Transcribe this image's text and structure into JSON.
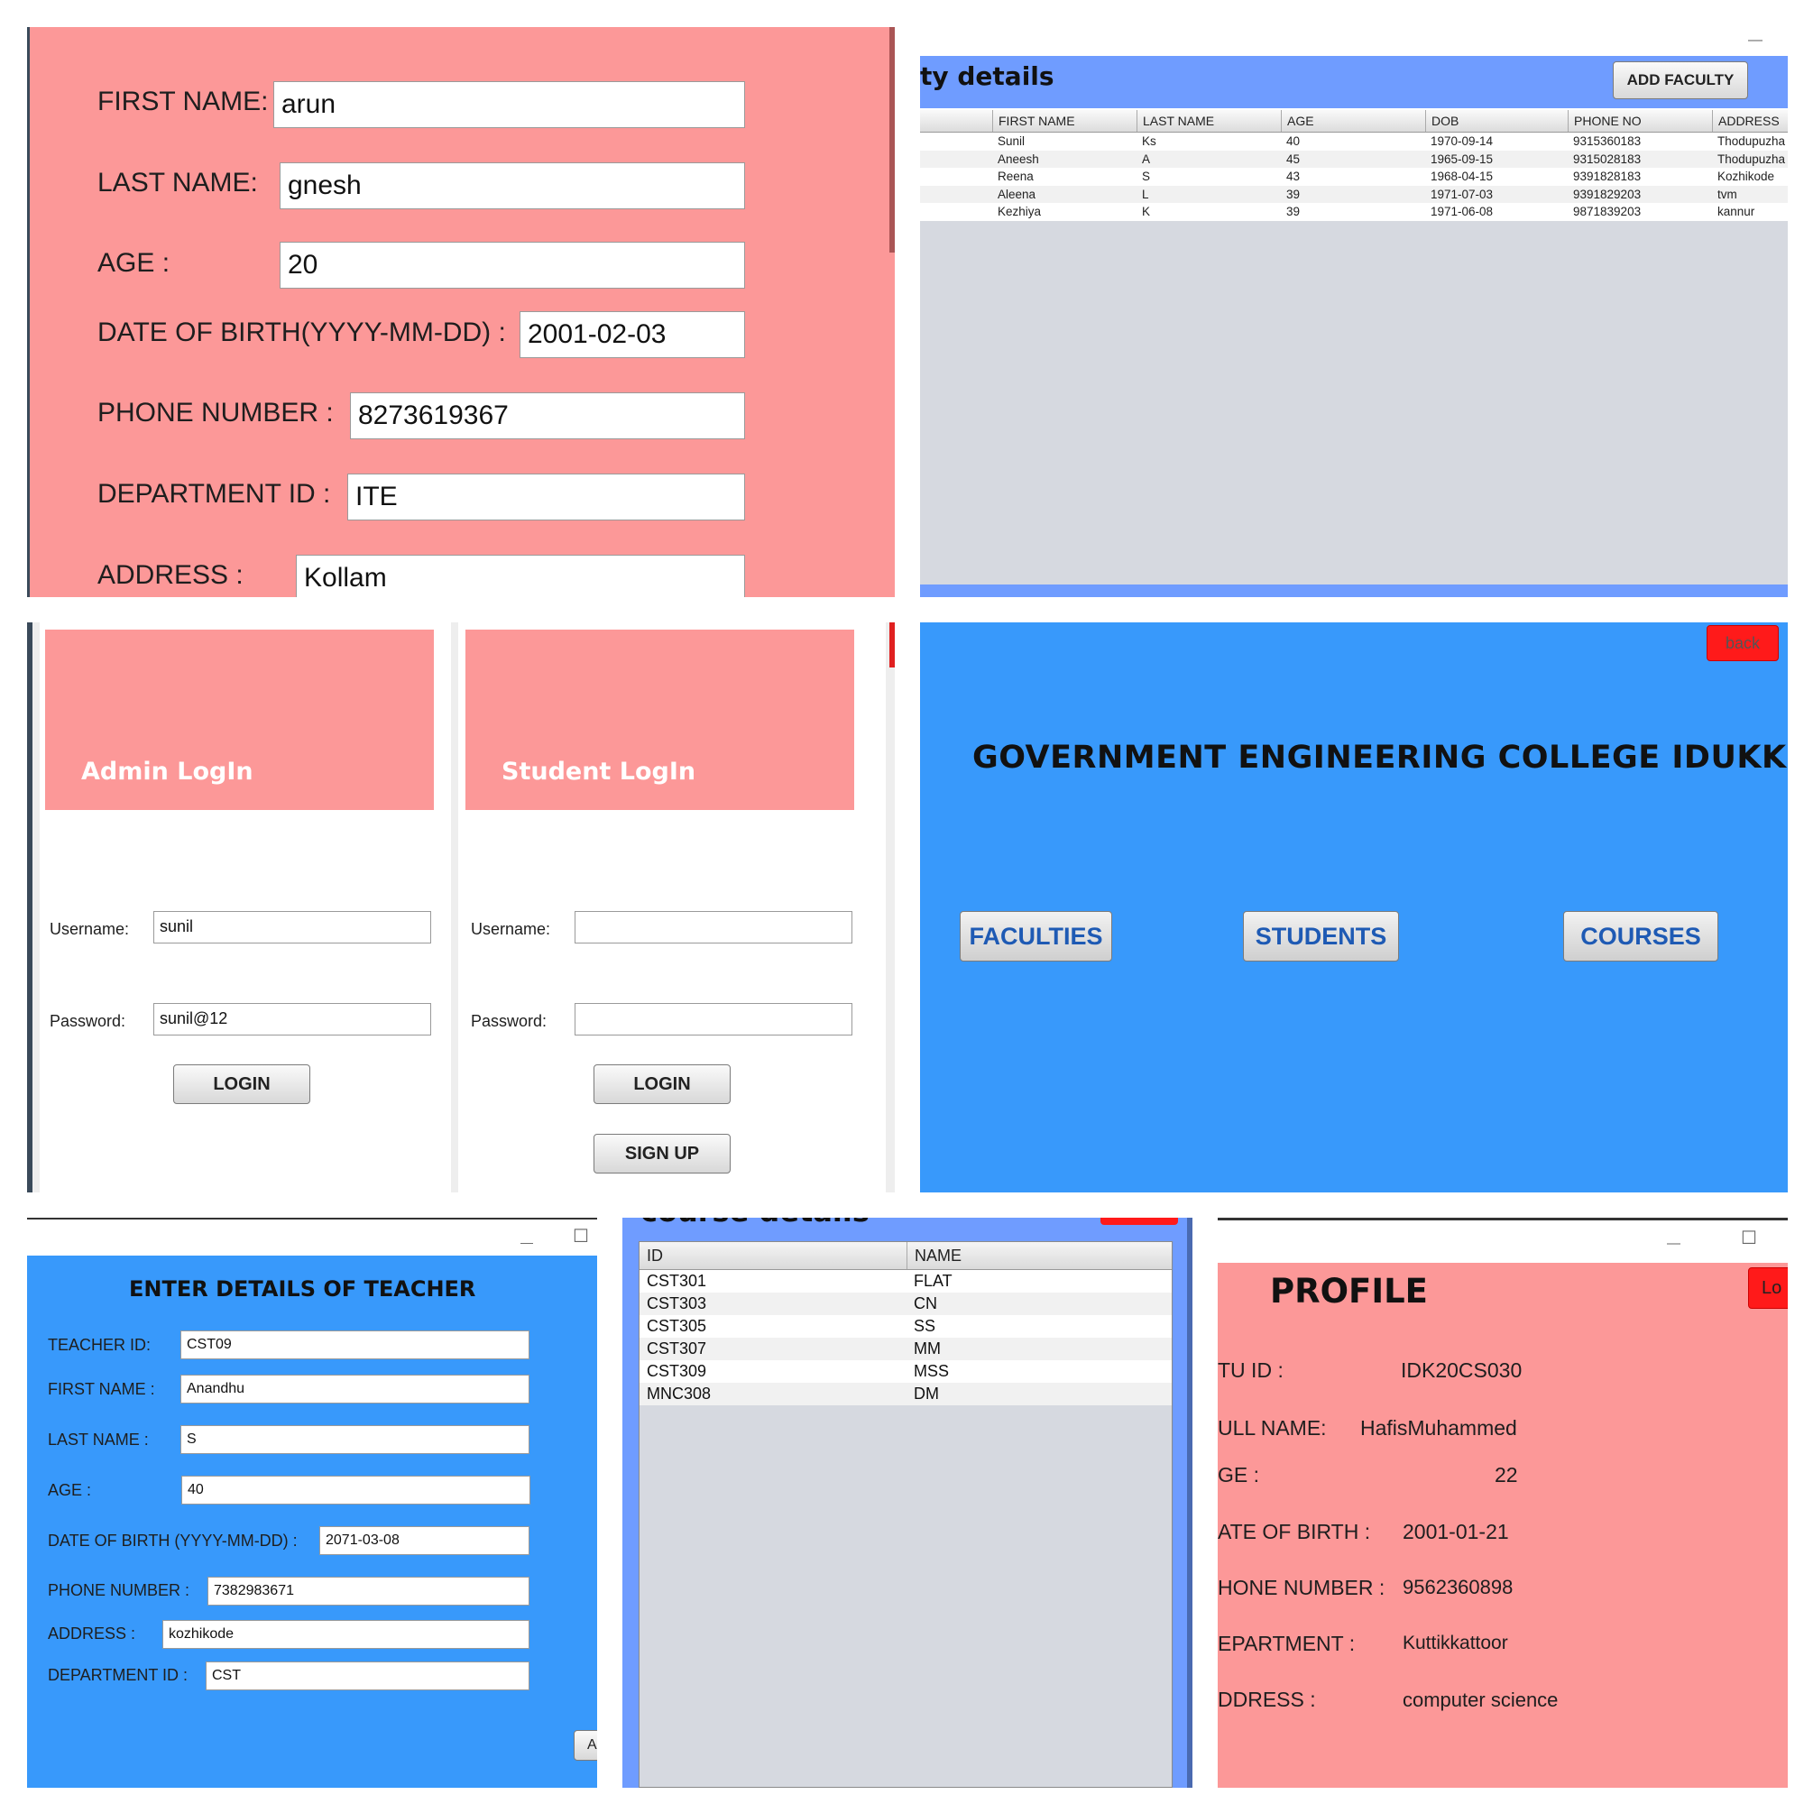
{
  "panel_teacher_form": {
    "first_name_label": "FIRST NAME:",
    "first_name_value": "arun",
    "last_name_label": "LAST NAME:",
    "last_name_value": "gnesh",
    "age_label": "AGE :",
    "age_value": "20",
    "dob_label": "DATE OF BIRTH(YYYY-MM-DD) :",
    "dob_value": "2001-02-03",
    "phone_label": "PHONE NUMBER :",
    "phone_value": "8273619367",
    "dept_label": "DEPARTMENT ID :",
    "dept_value": "ITE",
    "address_label": "ADDRESS :",
    "address_value": "Kollam"
  },
  "panel_faculty_details": {
    "title": "ty details",
    "add_button": "ADD FACULTY",
    "columns": [
      "FIRST NAME",
      "LAST NAME",
      "AGE",
      "DOB",
      "PHONE NO",
      "ADDRESS"
    ],
    "rows": [
      [
        "Sunil",
        "Ks",
        "40",
        "1970-09-14",
        "9315360183",
        "Thodupuzha"
      ],
      [
        "Aneesh",
        "A",
        "45",
        "1965-09-15",
        "9315028183",
        "Thodupuzha"
      ],
      [
        "Reena",
        "S",
        "43",
        "1968-04-15",
        "9391828183",
        "Kozhikode"
      ],
      [
        "Aleena",
        "L",
        "39",
        "1971-07-03",
        "9391829203",
        "tvm"
      ],
      [
        "Kezhiya",
        "K",
        "39",
        "1971-06-08",
        "9871839203",
        "kannur"
      ]
    ],
    "minimize_glyph": "—"
  },
  "panel_login": {
    "admin_title": "Admin LogIn",
    "student_title": "Student LogIn",
    "username_label": "Username:",
    "password_label": "Password:",
    "admin_username_value": "sunil",
    "admin_password_value": "sunil@12",
    "student_username_value": "",
    "student_password_value": "",
    "login_button": "LOGIN",
    "signup_button": "SIGN UP"
  },
  "panel_home": {
    "back_button": "back",
    "title": "GOVERNMENT ENGINEERING COLLEGE IDUKKI",
    "faculties_button": "FACULTIES",
    "students_button": "STUDENTS",
    "courses_button": "COURSES"
  },
  "panel_enter_teacher": {
    "title": "ENTER DETAILS OF TEACHER",
    "teacher_id_label": "TEACHER ID:",
    "teacher_id_value": "CST09",
    "first_name_label": "FIRST NAME :",
    "first_name_value": "Anandhu",
    "last_name_label": "LAST NAME :",
    "last_name_value": "S",
    "age_label": "AGE :",
    "age_value": "40",
    "dob_label": "DATE OF BIRTH (YYYY-MM-DD) :",
    "dob_value": "2071-03-08",
    "phone_label": "PHONE NUMBER :",
    "phone_value": "7382983671",
    "address_label": "ADDRESS :",
    "address_value": "kozhikode",
    "dept_label": "DEPARTMENT ID :",
    "dept_value": "CST",
    "partial_button": "A",
    "minimize_glyph": "—",
    "maximize_glyph": "☐"
  },
  "panel_course_details": {
    "title": "course details",
    "columns": [
      "ID",
      "NAME"
    ],
    "rows": [
      [
        "CST301",
        "FLAT"
      ],
      [
        "CST303",
        "CN"
      ],
      [
        "CST305",
        "SS"
      ],
      [
        "CST307",
        "MM"
      ],
      [
        "CST309",
        "MSS"
      ],
      [
        "MNC308",
        "DM"
      ]
    ]
  },
  "panel_profile": {
    "title": "PROFILE",
    "logout_button": "Lo",
    "stu_id_label": "TU ID :",
    "stu_id_value": "IDK20CS030",
    "full_name_label": "ULL NAME:",
    "full_name_value": "HafisMuhammed",
    "age_label": "GE :",
    "age_value": "22",
    "dob_label": "ATE OF BIRTH :",
    "dob_value": "2001-01-21",
    "phone_label": "HONE NUMBER :",
    "phone_value": "9562360898",
    "dept_label": "EPARTMENT :",
    "dept_value": "Kuttikkattoor",
    "address_label": "DDRESS :",
    "address_value": "computer science",
    "minimize_glyph": "—",
    "maximize_glyph": "☐"
  },
  "colors": {
    "pink": "#fc9898",
    "blue": "#3899fb",
    "table_header_blue": "#6f9cff",
    "gray_area": "#d6d9e0",
    "red_button": "#ff1a1a"
  }
}
